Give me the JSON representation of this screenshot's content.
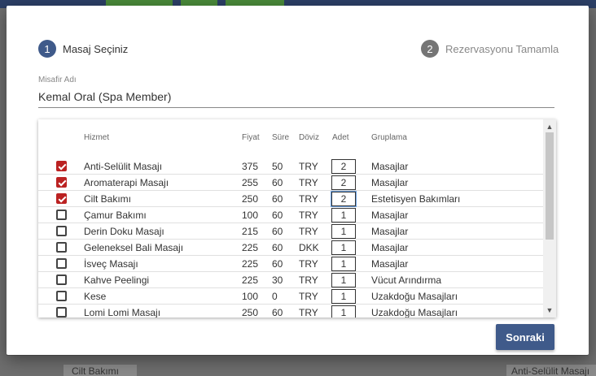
{
  "background": {
    "left_cell": "Cilt Bakımı",
    "right_cell": "Anti-Selülit Masajı"
  },
  "stepper": {
    "step1": {
      "number": "1",
      "label": "Masaj Seçiniz"
    },
    "step2": {
      "number": "2",
      "label": "Rezervasyonu Tamamla"
    }
  },
  "guest": {
    "label": "Misafir Adı",
    "value": "Kemal Oral (Spa Member)"
  },
  "table": {
    "headers": {
      "service": "Hizmet",
      "price": "Fiyat",
      "duration": "Süre",
      "currency": "Döviz",
      "quantity": "Adet",
      "group": "Gruplama"
    },
    "rows": [
      {
        "checked": true,
        "service": "Anti-Selülit Masajı",
        "price": "375",
        "duration": "50",
        "currency": "TRY",
        "quantity": "2",
        "group": "Masajlar"
      },
      {
        "checked": true,
        "service": "Aromaterapi Masajı",
        "price": "255",
        "duration": "60",
        "currency": "TRY",
        "quantity": "2",
        "group": "Masajlar"
      },
      {
        "checked": true,
        "service": "Cilt Bakımı",
        "price": "250",
        "duration": "60",
        "currency": "TRY",
        "quantity": "2",
        "group": "Estetisyen Bakımları"
      },
      {
        "checked": false,
        "service": "Çamur Bakımı",
        "price": "100",
        "duration": "60",
        "currency": "TRY",
        "quantity": "1",
        "group": "Masajlar"
      },
      {
        "checked": false,
        "service": "Derin Doku Masajı",
        "price": "215",
        "duration": "60",
        "currency": "TRY",
        "quantity": "1",
        "group": "Masajlar"
      },
      {
        "checked": false,
        "service": "Geleneksel Bali Masajı",
        "price": "225",
        "duration": "60",
        "currency": "DKK",
        "quantity": "1",
        "group": "Masajlar"
      },
      {
        "checked": false,
        "service": "İsveç Masajı",
        "price": "225",
        "duration": "60",
        "currency": "TRY",
        "quantity": "1",
        "group": "Masajlar"
      },
      {
        "checked": false,
        "service": "Kahve Peelingi",
        "price": "225",
        "duration": "30",
        "currency": "TRY",
        "quantity": "1",
        "group": "Vücut Arındırma"
      },
      {
        "checked": false,
        "service": "Kese",
        "price": "100",
        "duration": "0",
        "currency": "TRY",
        "quantity": "1",
        "group": "Uzakdoğu Masajları"
      },
      {
        "checked": false,
        "service": "Lomi Lomi Masajı",
        "price": "250",
        "duration": "60",
        "currency": "TRY",
        "quantity": "1",
        "group": "Uzakdoğu Masajları"
      }
    ]
  },
  "scroll": {
    "up_icon": "chevron-up-icon",
    "down_icon": "chevron-down-icon"
  },
  "actions": {
    "next_label": "Sonraki"
  },
  "colors": {
    "primary": "#3f5a8a",
    "checkbox_checked": "#bb2222",
    "step_inactive": "#757575"
  }
}
